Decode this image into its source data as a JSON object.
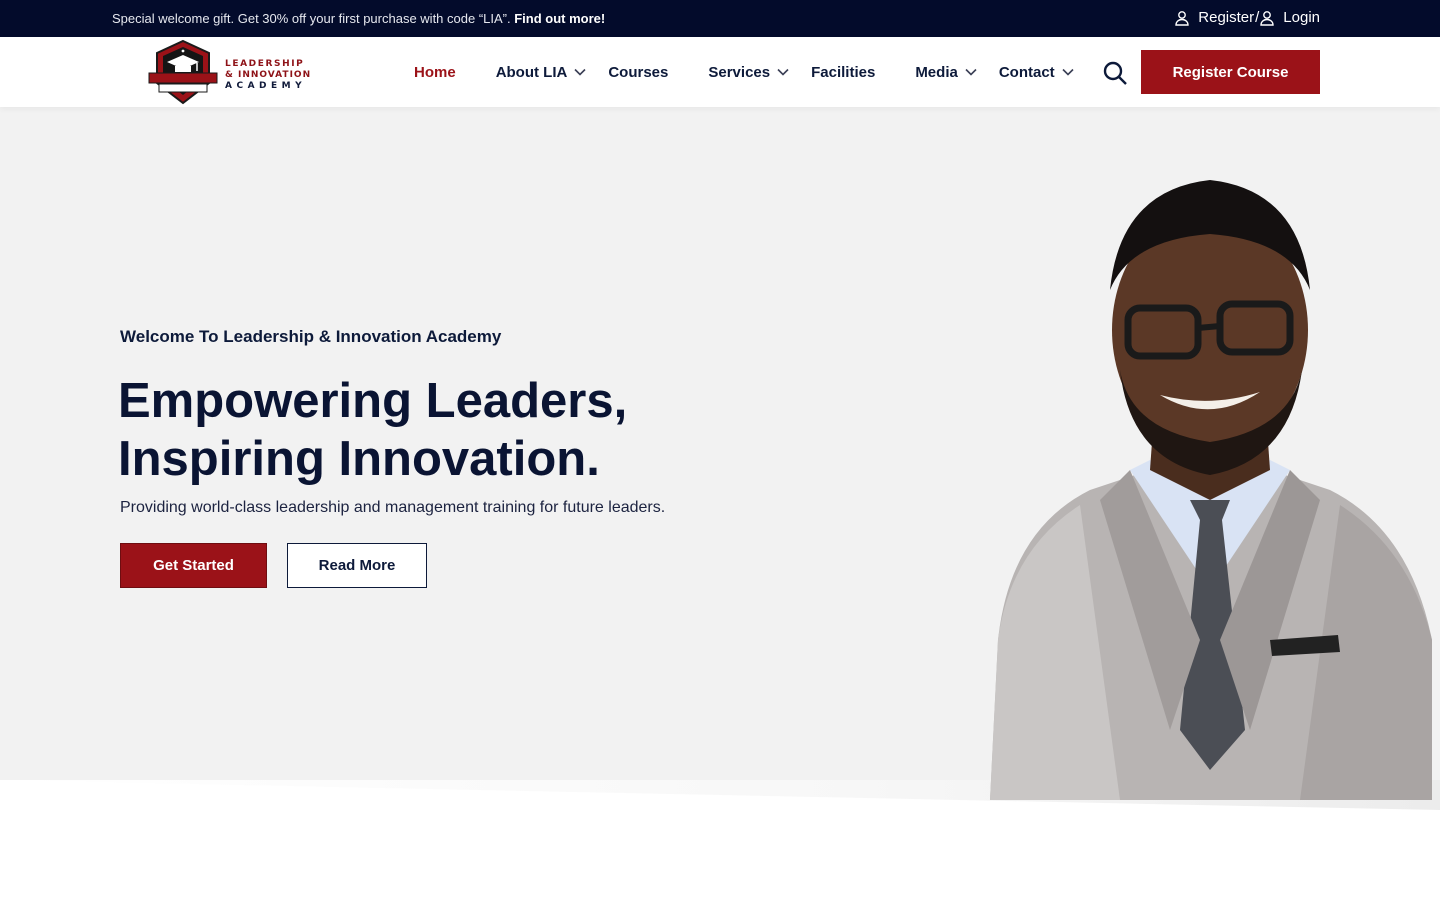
{
  "topbar": {
    "message": "Special welcome gift. Get 30% off your first purchase with code “LIA”.",
    "message_link": "Find out more!",
    "register": "Register",
    "separator": "/",
    "login": "Login"
  },
  "header": {
    "logo": {
      "line1": "LEADERSHIP",
      "line2": "& INNOVATION",
      "line3": "ACADEMY"
    },
    "nav": [
      {
        "label": "Home",
        "active": true,
        "dropdown": false
      },
      {
        "label": "About LIA",
        "active": false,
        "dropdown": true
      },
      {
        "label": "Courses",
        "active": false,
        "dropdown": false
      },
      {
        "label": "Services",
        "active": false,
        "dropdown": true
      },
      {
        "label": "Facilities",
        "active": false,
        "dropdown": false
      },
      {
        "label": "Media",
        "active": false,
        "dropdown": true
      },
      {
        "label": "Contact",
        "active": false,
        "dropdown": true
      }
    ],
    "search_icon": "search-icon",
    "cta": "Register Course"
  },
  "hero": {
    "welcome": "Welcome To Leadership & Innovation Academy",
    "headline_line1": "Empowering Leaders,",
    "headline_line2": "Inspiring Innovation.",
    "subline": "Providing world-class leadership and management training for future leaders.",
    "primary_button": "Get Started",
    "secondary_button": "Read More"
  },
  "colors": {
    "brand_red": "#9b1218",
    "navy": "#030b2b",
    "hero_bg": "#f2f2f2"
  }
}
